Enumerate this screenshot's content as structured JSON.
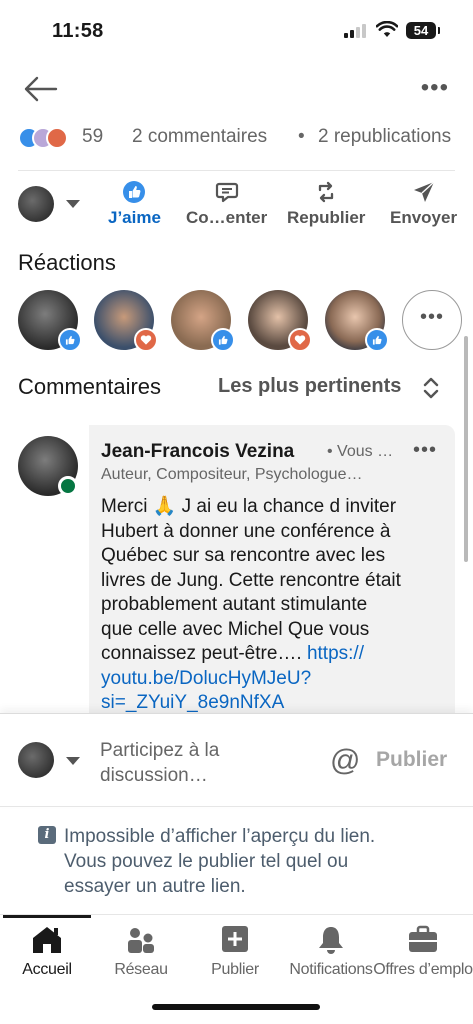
{
  "status_bar": {
    "time": "11:58",
    "battery": "54"
  },
  "post_stats": {
    "reaction_count": "59",
    "comments": "2 commentaires",
    "separator": "•",
    "reposts": "2 republications"
  },
  "actions": {
    "like": "J’aime",
    "comment": "Co…enter",
    "repost": "Republier",
    "send": "Envoyer"
  },
  "reactions": {
    "title": "Réactions",
    "more": "•••"
  },
  "comments_section": {
    "title": "Commentaires",
    "sort_label": "Les plus pertinents"
  },
  "comment": {
    "author": "Jean-Francois Vezina",
    "you_tag": "• Vous …",
    "headline": "Auteur, Compositeur, Psychologue…",
    "more": "•••",
    "text": "Merci 🙏 J ai eu la chance d inviter\nHubert à donner une conférence à\nQuébec sur sa rencontre avec les\nlivres de Jung. Cette rencontre était\nprobablement autant stimulante\nque celle avec Michel Que vous\nconnaissez peut-être…. ",
    "link": "https://\nyoutu.be/DolucHyMJeU?\nsi=_ZYuiY_8e9nNfXA"
  },
  "composer": {
    "placeholder": "Participez à la\ndiscussion…",
    "mention_symbol": "@",
    "post_label": "Publier"
  },
  "notice": {
    "icon_letter": "i",
    "text": "Impossible d’afficher l’aperçu du lien.\nVous pouvez le publier tel quel ou\nessayer un autre lien."
  },
  "bottom_nav": [
    {
      "label": "Accueil",
      "icon": "home-icon"
    },
    {
      "label": "Réseau",
      "icon": "network-icon"
    },
    {
      "label": "Publier",
      "icon": "post-plus-icon"
    },
    {
      "label": "Notifications",
      "icon": "bell-icon"
    },
    {
      "label": "Offres d’emplo",
      "icon": "briefcase-icon"
    }
  ],
  "colors": {
    "accent_blue": "#0a66c2",
    "heart_red": "#e06847",
    "online_green": "#057642"
  }
}
